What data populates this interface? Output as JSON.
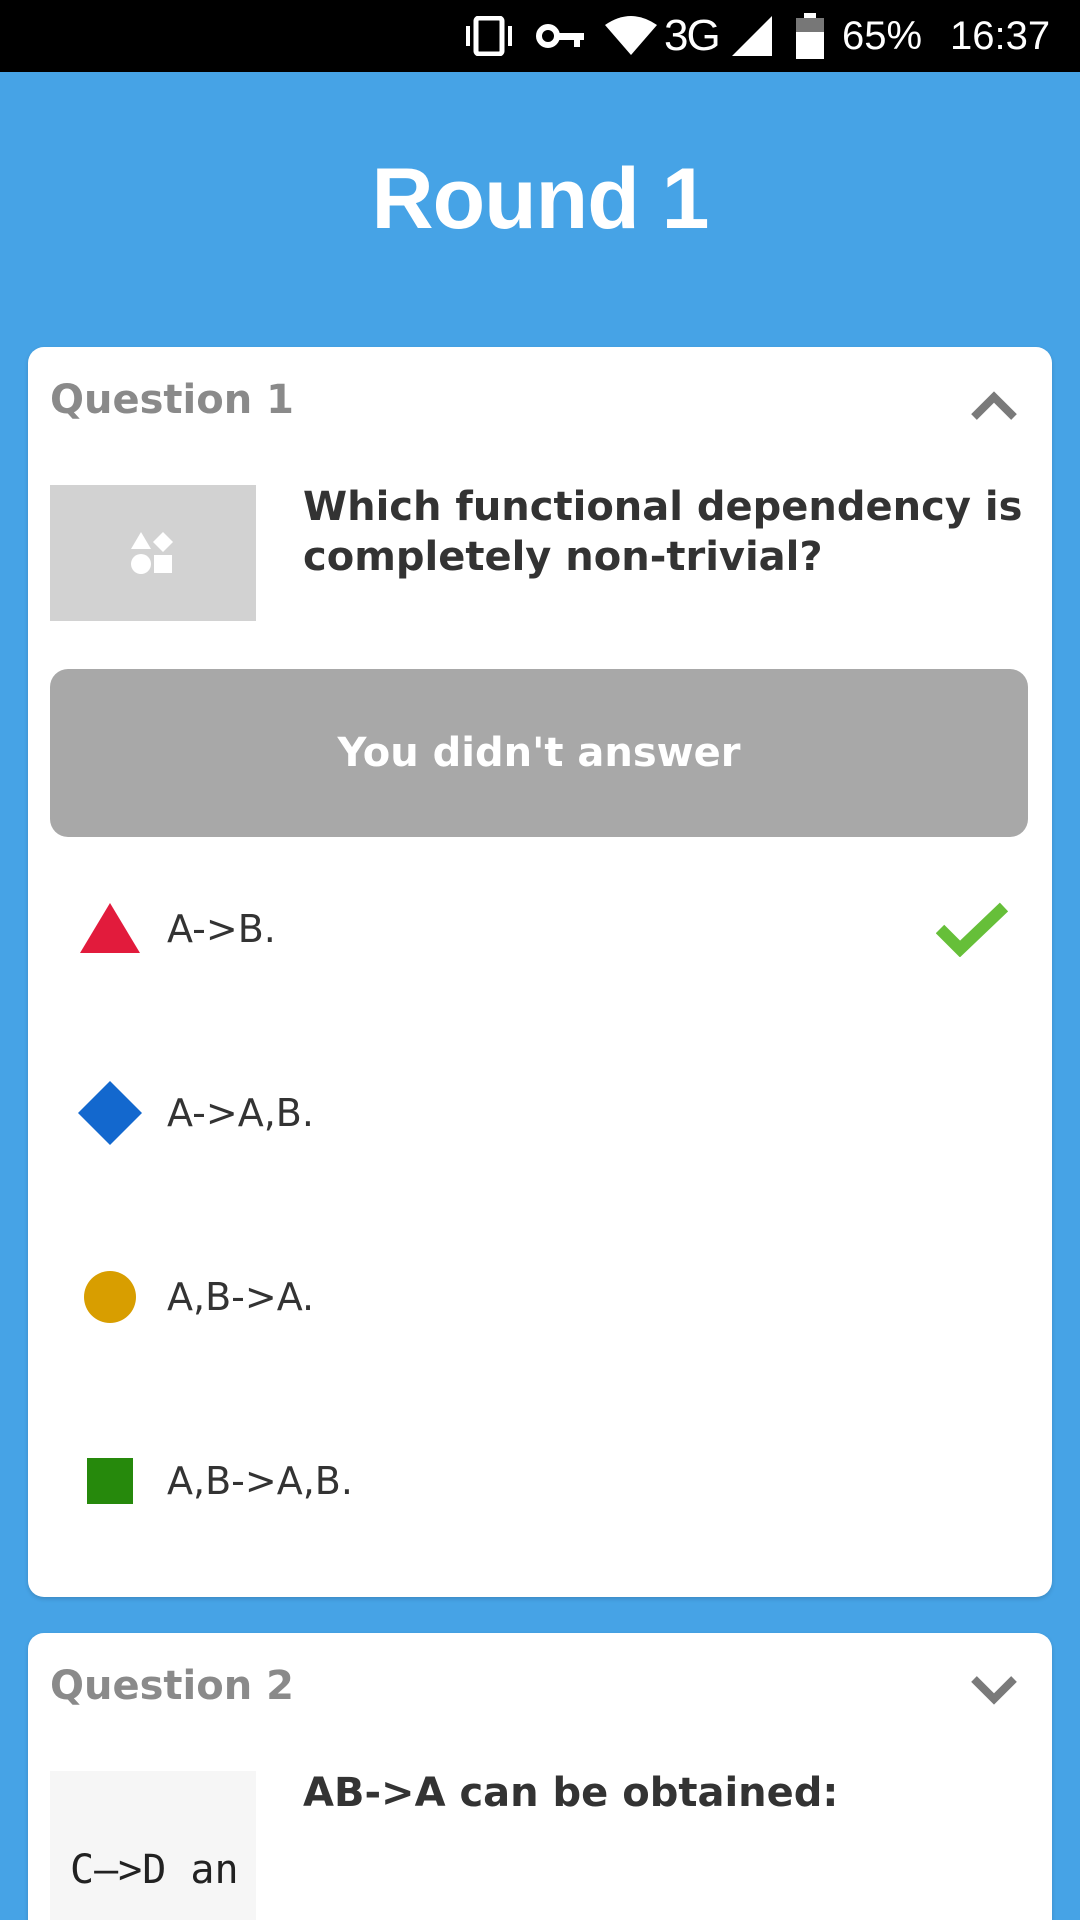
{
  "status_bar": {
    "network": "3G",
    "battery": "65%",
    "time": "16:37",
    "icons": [
      "vibrate-icon",
      "vpn-key-icon",
      "wifi-icon",
      "signal-icon",
      "battery-icon"
    ]
  },
  "round": {
    "title": "Round 1"
  },
  "questions": [
    {
      "label": "Question 1",
      "expanded": true,
      "text": "Which functional dependency is completely non-trivial?",
      "result": "You didn't answer",
      "options": [
        {
          "label": "A->B.",
          "shape": "triangle",
          "color": "#e21b3c",
          "correct": true
        },
        {
          "label": "A->A,B.",
          "shape": "diamond",
          "color": "#1368ce",
          "correct": false
        },
        {
          "label": "A,B->A.",
          "shape": "circle",
          "color": "#d89e00",
          "correct": false
        },
        {
          "label": "A,B->A,B.",
          "shape": "square",
          "color": "#26890c",
          "correct": false
        }
      ]
    },
    {
      "label": "Question 2",
      "expanded": false,
      "text": "AB->A can be obtained:",
      "thumb_text": "C—>D an"
    }
  ],
  "colors": {
    "background": "#46a3e6",
    "banner": "#a8a8a8",
    "check": "#66bf39"
  }
}
